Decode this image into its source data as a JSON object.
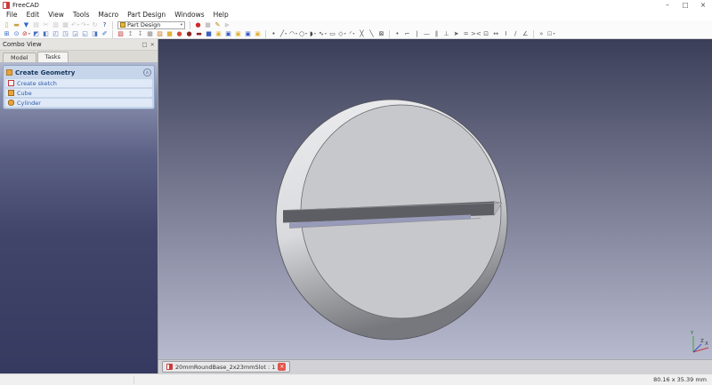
{
  "window": {
    "title": "FreeCAD",
    "controls": {
      "minimize": "–",
      "maximize": "□",
      "close": "×"
    }
  },
  "menu": {
    "items": [
      {
        "name": "menu-file",
        "label": "File"
      },
      {
        "name": "menu-edit",
        "label": "Edit"
      },
      {
        "name": "menu-view",
        "label": "View"
      },
      {
        "name": "menu-tools",
        "label": "Tools"
      },
      {
        "name": "menu-macro",
        "label": "Macro"
      },
      {
        "name": "menu-part-design",
        "label": "Part Design"
      },
      {
        "name": "menu-windows",
        "label": "Windows"
      },
      {
        "name": "menu-help",
        "label": "Help"
      }
    ]
  },
  "toolbars": {
    "file": [
      {
        "name": "new-file-icon",
        "glyph": "▯",
        "color": "#caa23a"
      },
      {
        "name": "open-file-icon",
        "glyph": "▬",
        "color": "#c9a24a"
      },
      {
        "name": "save-icon",
        "glyph": "▼",
        "color": "#2f66cc"
      },
      {
        "name": "print-icon",
        "glyph": "▤",
        "color": "#777777",
        "disabled": true
      },
      {
        "name": "cut-icon",
        "glyph": "✂",
        "color": "#777777",
        "disabled": true
      },
      {
        "name": "copy-icon",
        "glyph": "▥",
        "color": "#777777",
        "disabled": true
      },
      {
        "name": "paste-icon",
        "glyph": "▦",
        "color": "#777777",
        "disabled": true
      },
      {
        "name": "undo-icon",
        "glyph": "↶",
        "color": "#777777",
        "disabled": true,
        "dropdown": true
      },
      {
        "name": "redo-icon",
        "glyph": "↷",
        "color": "#777777",
        "disabled": true,
        "dropdown": true
      },
      {
        "name": "refresh-icon",
        "glyph": "↻",
        "color": "#777777",
        "disabled": true
      },
      {
        "name": "whats-this-icon",
        "glyph": "?",
        "color": "#1d3f8a"
      }
    ],
    "workbench": {
      "value": "Part Design"
    },
    "macro": [
      {
        "name": "macro-record-icon",
        "glyph": "●",
        "color": "#cf2a2a"
      },
      {
        "name": "macro-stop-icon",
        "glyph": "■",
        "color": "#777777",
        "disabled": true
      },
      {
        "name": "macro-edit-icon",
        "glyph": "✎",
        "color": "#b8860b"
      },
      {
        "name": "macro-execute-icon",
        "glyph": "▶",
        "color": "#5aa85a",
        "disabled": true
      }
    ],
    "view": [
      {
        "name": "fit-all-icon",
        "glyph": "⊞",
        "color": "#2f66cc"
      },
      {
        "name": "box-zoom-icon",
        "glyph": "⊙",
        "color": "#2f66cc"
      },
      {
        "name": "draw-style-icon",
        "glyph": "⊘",
        "color": "#cc2222",
        "dropdown": true
      },
      {
        "name": "view-isometric-icon",
        "glyph": "◩",
        "color": "#4a6fc0"
      },
      {
        "name": "view-front-icon",
        "glyph": "◧",
        "color": "#4a6fc0"
      },
      {
        "name": "view-top-icon",
        "glyph": "◰",
        "color": "#4a6fc0"
      },
      {
        "name": "view-right-icon",
        "glyph": "◳",
        "color": "#4a6fc0"
      },
      {
        "name": "view-rear-icon",
        "glyph": "◲",
        "color": "#4a6fc0"
      },
      {
        "name": "view-bottom-icon",
        "glyph": "◱",
        "color": "#4a6fc0"
      },
      {
        "name": "view-left-icon",
        "glyph": "◨",
        "color": "#4a6fc0"
      },
      {
        "name": "measure-icon",
        "glyph": "✐",
        "color": "#2f66cc"
      }
    ],
    "sketch": [
      {
        "name": "new-sketch-icon",
        "glyph": "▨",
        "color": "#c23a3a"
      },
      {
        "name": "edit-sketch-icon",
        "glyph": "↥",
        "color": "#8a8a8a"
      },
      {
        "name": "leave-sketch-icon",
        "glyph": "↧",
        "color": "#8a8a8a"
      },
      {
        "name": "view-sketch-icon",
        "glyph": "▦",
        "color": "#8a8a8a"
      },
      {
        "name": "map-sketch-icon",
        "glyph": "▧",
        "color": "#d07828"
      }
    ],
    "feature": [
      {
        "name": "pad-icon",
        "glyph": "■",
        "color": "#e0b33a"
      },
      {
        "name": "revolution-icon",
        "glyph": "●",
        "color": "#cf4a3a"
      },
      {
        "name": "groove-icon",
        "glyph": "●",
        "color": "#8e2222"
      },
      {
        "name": "loft-icon",
        "glyph": "▬",
        "color": "#8e2222"
      },
      {
        "name": "pocket-icon",
        "glyph": "■",
        "color": "#3a5fc0"
      },
      {
        "name": "hole-icon",
        "glyph": "▣",
        "color": "#e0b33a"
      },
      {
        "name": "linear-pattern-icon",
        "glyph": "▣",
        "color": "#3a5fc0"
      },
      {
        "name": "polar-pattern-icon",
        "glyph": "▣",
        "color": "#e0b33a"
      },
      {
        "name": "mirrored-icon",
        "glyph": "▣",
        "color": "#3a5fc0"
      },
      {
        "name": "multi-transform-icon",
        "glyph": "▣",
        "color": "#e0b33a"
      }
    ],
    "geometry": [
      {
        "name": "create-point-icon",
        "glyph": "•",
        "color": "#444444"
      },
      {
        "name": "create-line-icon",
        "glyph": "╱",
        "color": "#444444",
        "dropdown": true
      },
      {
        "name": "create-arc-icon",
        "glyph": "◠",
        "color": "#444444",
        "dropdown": true
      },
      {
        "name": "create-circle-icon",
        "glyph": "○",
        "color": "#444444",
        "dropdown": true
      },
      {
        "name": "create-conic-icon",
        "glyph": "◗",
        "color": "#444444",
        "dropdown": true
      },
      {
        "name": "create-bspline-icon",
        "glyph": "∿",
        "color": "#444444",
        "dropdown": true
      },
      {
        "name": "create-rectangle-icon",
        "glyph": "▭",
        "color": "#444444"
      },
      {
        "name": "create-polygon-icon",
        "glyph": "◇",
        "color": "#444444",
        "dropdown": true
      },
      {
        "name": "create-fillet-icon",
        "glyph": "◜",
        "color": "#444444",
        "dropdown": true
      },
      {
        "name": "trim-edge-icon",
        "glyph": "╳",
        "color": "#444444"
      },
      {
        "name": "extend-edge-icon",
        "glyph": "╲",
        "color": "#444444"
      },
      {
        "name": "external-geometry-icon",
        "glyph": "⊠",
        "color": "#444444"
      }
    ],
    "constraint": [
      {
        "name": "constrain-coincident-icon",
        "glyph": "•",
        "color": "#555555"
      },
      {
        "name": "constrain-point-on-object-icon",
        "glyph": "⌐",
        "color": "#555555"
      },
      {
        "name": "constrain-vertical-icon",
        "glyph": "|",
        "color": "#555555"
      },
      {
        "name": "constrain-horizontal-icon",
        "glyph": "—",
        "color": "#555555"
      },
      {
        "name": "constrain-parallel-icon",
        "glyph": "∥",
        "color": "#555555"
      },
      {
        "name": "constrain-perpendicular-icon",
        "glyph": "⊥",
        "color": "#555555"
      },
      {
        "name": "constrain-tangent-icon",
        "glyph": "➤",
        "color": "#555555"
      },
      {
        "name": "constrain-equal-icon",
        "glyph": "=",
        "color": "#555555"
      },
      {
        "name": "constrain-symmetric-icon",
        "glyph": "><",
        "color": "#555555"
      },
      {
        "name": "constrain-lock-icon",
        "glyph": "⊡",
        "color": "#555555"
      },
      {
        "name": "constrain-horizontal-distance-icon",
        "glyph": "↔",
        "color": "#555555"
      },
      {
        "name": "constrain-vertical-distance-icon",
        "glyph": "I",
        "color": "#555555"
      },
      {
        "name": "constrain-distance-icon",
        "glyph": "∕",
        "color": "#555555"
      },
      {
        "name": "constrain-angle-icon",
        "glyph": "∠",
        "color": "#555555"
      }
    ],
    "tail": [
      {
        "name": "toolbar-overflow-icon",
        "glyph": "»",
        "color": "#666666"
      },
      {
        "name": "selection-filter-icon",
        "glyph": "⊡",
        "color": "#888888",
        "dropdown": true
      }
    ]
  },
  "combo_view": {
    "title": "Combo View",
    "float_glyph": "□",
    "close_glyph": "×",
    "tabs": [
      {
        "name": "tab-model",
        "label": "Model"
      },
      {
        "name": "tab-tasks",
        "label": "Tasks",
        "active": true
      }
    ],
    "task_group": {
      "header": "Create Geometry",
      "collapse_glyph": "∧",
      "items": [
        {
          "name": "task-item-create-sketch",
          "label": "Create sketch",
          "iconColor": "#f7f7f7",
          "iconBorder": "#c23a3a",
          "iconRadius": "0"
        },
        {
          "name": "task-item-cube",
          "label": "Cube",
          "iconColor": "#e8a33d",
          "iconBorder": "#a06a1a",
          "iconRadius": "0"
        },
        {
          "name": "task-item-cylinder",
          "label": "Cylinder",
          "iconColor": "#e8a33d",
          "iconBorder": "#a06a1a",
          "iconRadius": "50% / 35%"
        }
      ]
    }
  },
  "viewport": {
    "axis": {
      "x": "X",
      "y": "Y",
      "z": "Z"
    }
  },
  "colors": {
    "viewport_bg_top": "#3b3e58",
    "viewport_bg_bottom": "#b8bacf",
    "model_face": "#c7c8cc",
    "model_rim_light": "#ededef",
    "model_rim_dark": "#77787d",
    "slot_wall": "#5d5e63",
    "slot_through": "#979ab8",
    "slot_endcap": "#b4b5b9"
  },
  "doc_tab": {
    "label": "20mmRoundBase_2x23mmSlot : 1",
    "close_glyph": "×"
  },
  "status": {
    "dimensions": "80.16 x 35.39 mm"
  }
}
